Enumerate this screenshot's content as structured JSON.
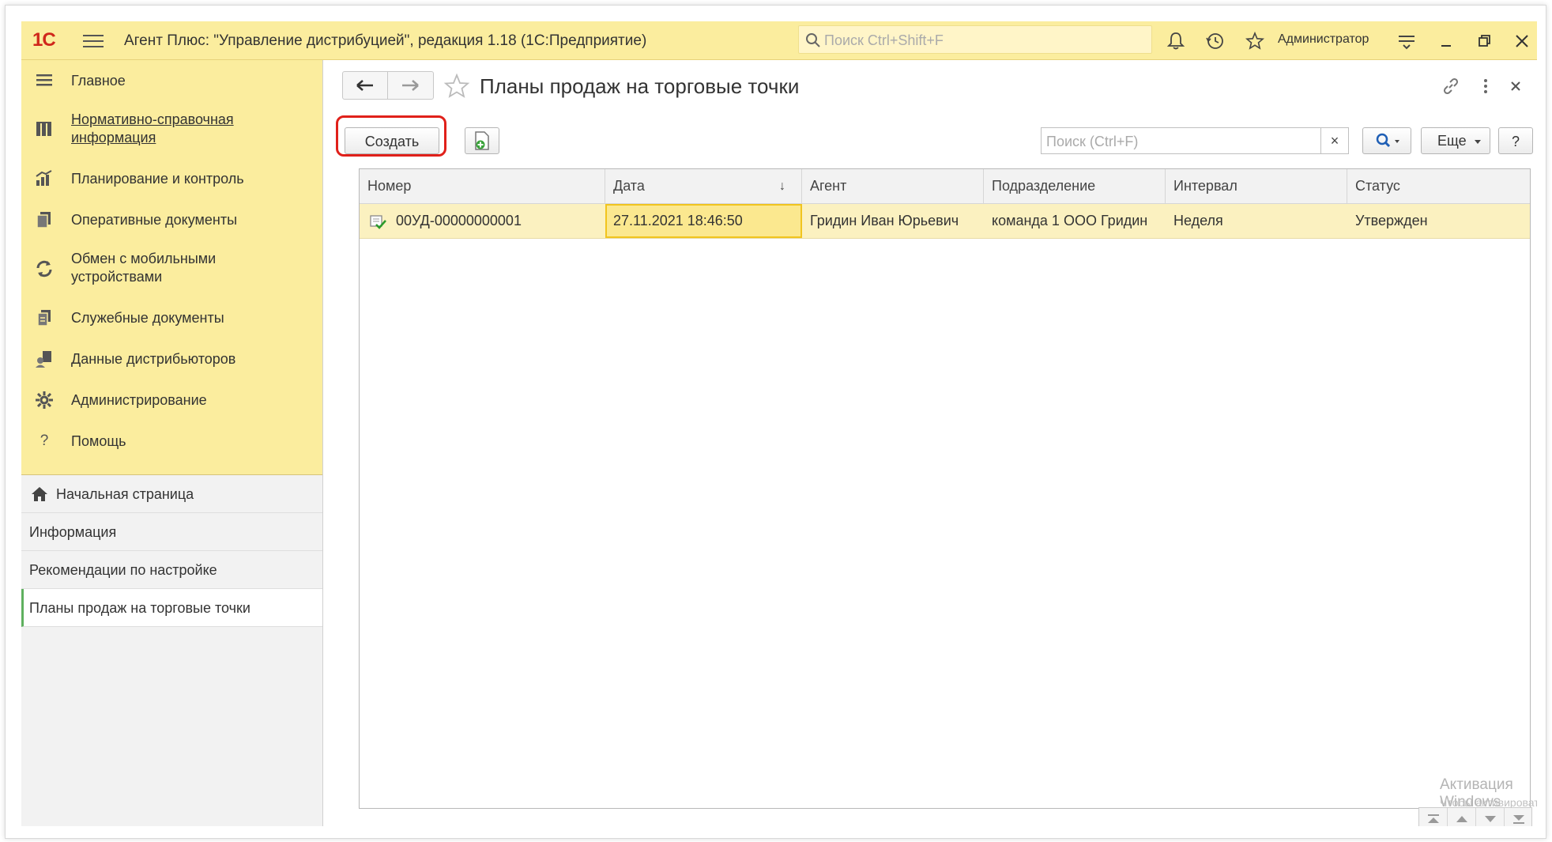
{
  "window": {
    "app_title": "Агент Плюс: \"Управление дистрибуцией\", редакция 1.18  (1С:Предприятие)",
    "global_search_placeholder": "Поиск Ctrl+Shift+F",
    "user": "Администратор",
    "logo_text": "1С",
    "brand_color": "#fbed9e"
  },
  "sidebar": {
    "sections": [
      {
        "label": "Главное",
        "icon": "menu-icon"
      },
      {
        "label": "Нормативно-справочная информация",
        "icon": "catalog-icon"
      },
      {
        "label": "Планирование и контроль",
        "icon": "chart-icon"
      },
      {
        "label": "Оперативные документы",
        "icon": "documents-icon"
      },
      {
        "label": "Обмен с мобильными устройствами",
        "icon": "sync-icon"
      },
      {
        "label": "Служебные документы",
        "icon": "service-docs-icon"
      },
      {
        "label": "Данные дистрибьюторов",
        "icon": "distributors-icon"
      },
      {
        "label": "Администрирование",
        "icon": "gear-icon"
      },
      {
        "label": "Помощь",
        "icon": "help-icon"
      }
    ],
    "open_tabs": [
      {
        "label": "Начальная страница"
      },
      {
        "label": "Информация"
      },
      {
        "label": "Рекомендации по настройке"
      },
      {
        "label": "Планы продаж на торговые точки"
      }
    ]
  },
  "main": {
    "title": "Планы продаж на торговые точки",
    "create_label": "Создать",
    "search_placeholder": "Поиск (Ctrl+F)",
    "clear_label": "×",
    "more_label": "Еще",
    "help_label": "?",
    "columns": [
      "Номер",
      "Дата",
      "Агент",
      "Подразделение",
      "Интервал",
      "Статус"
    ],
    "rows": [
      {
        "number": "00УД-00000000001",
        "date": "27.11.2021 18:46:50",
        "agent": "Гридин Иван Юрьевич",
        "department": "команда 1 ООО Гридин",
        "interval": "Неделя",
        "status": "Утвержден"
      }
    ]
  },
  "watermark": {
    "line1": "Активация Windows",
    "line2": "Чтобы активировать Windows, перейдите в раздел \"Параметры\"."
  }
}
